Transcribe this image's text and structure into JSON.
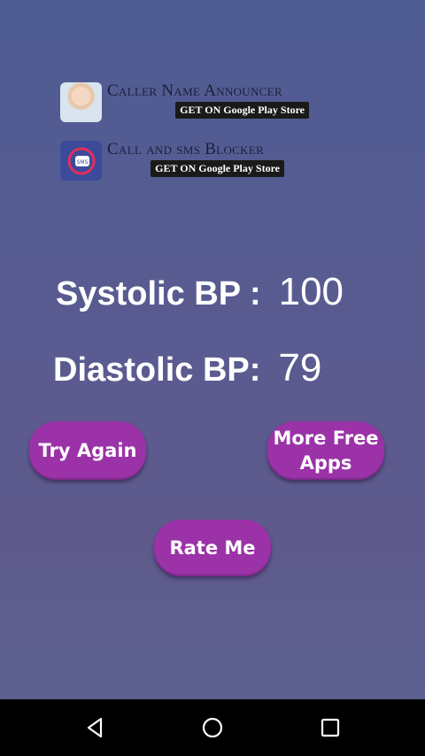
{
  "promos": [
    {
      "name": "Caller Name Announcer",
      "store": "GET ON Google Play Store",
      "icon": "caller-person-icon"
    },
    {
      "name": "Call and sms Blocker",
      "store": "GET ON Google Play Store",
      "icon": "sms-blocker-icon",
      "icon_text": "SMS"
    }
  ],
  "systolic": {
    "label": "Systolic BP :",
    "value": "100"
  },
  "diastolic": {
    "label": "Diastolic BP:",
    "value": "79"
  },
  "buttons": {
    "try_again": "Try Again",
    "more_free_apps_line1": "More Free",
    "more_free_apps_line2": "Apps",
    "rate_me": "Rate Me"
  },
  "colors": {
    "button": "#9b32a8",
    "background": "#5a5b90"
  },
  "navbar": {
    "icons": [
      "back-icon",
      "home-icon",
      "recents-icon"
    ]
  }
}
